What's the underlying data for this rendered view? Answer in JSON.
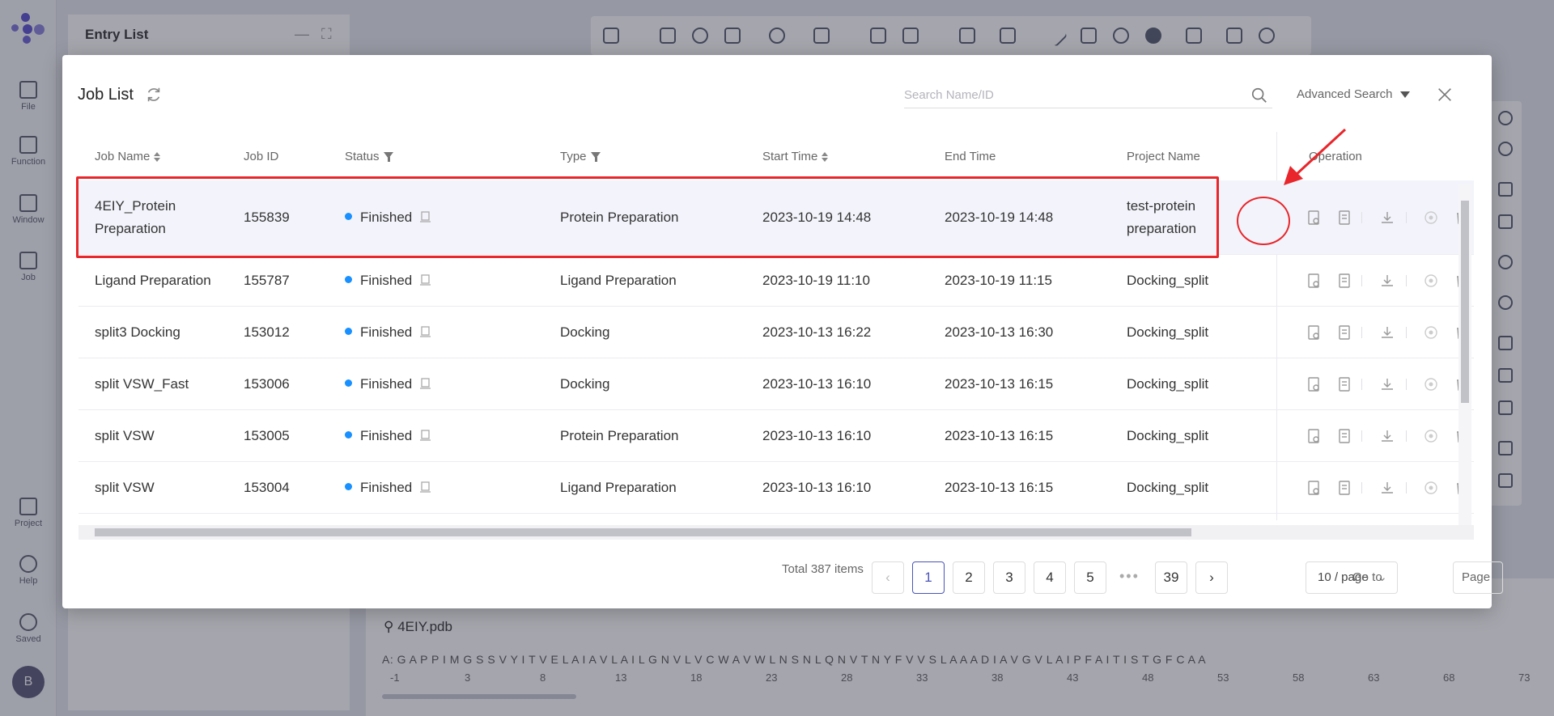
{
  "sidebar": {
    "items": [
      {
        "label": "File"
      },
      {
        "label": "Function"
      },
      {
        "label": "Window"
      },
      {
        "label": "Job"
      },
      {
        "label": "Project"
      },
      {
        "label": "Help"
      },
      {
        "label": "Saved"
      }
    ],
    "avatar": "B"
  },
  "entry_list": {
    "title": "Entry List"
  },
  "sequence": {
    "file": "4EIY.pdb",
    "chain": "A: G A P P I M G S S V Y I T V E L A I A V L A I L G N V L V C W A V W L N S N L Q N V T N Y F V V S L A A A D I A V G V L A I P F A I T I S T G F C A A",
    "numbers": [
      "-1",
      "3",
      "8",
      "13",
      "18",
      "23",
      "28",
      "33",
      "38",
      "43",
      "48",
      "53",
      "58",
      "63",
      "68",
      "73"
    ]
  },
  "dialog": {
    "title": "Job List",
    "search_placeholder": "Search Name/ID",
    "advanced_search": "Advanced Search",
    "columns": {
      "job_name": "Job Name",
      "job_id": "Job ID",
      "status": "Status",
      "type": "Type",
      "start_time": "Start Time",
      "end_time": "End Time",
      "project_name": "Project Name",
      "operation": "Operation"
    },
    "rows": [
      {
        "name": "4EIY_Protein Preparation",
        "id": "155839",
        "status": "Finished",
        "type": "Protein Preparation",
        "start": "2023-10-19 14:48",
        "end": "2023-10-19 14:48",
        "project": "test-protein preparation"
      },
      {
        "name": "Ligand Preparation",
        "id": "155787",
        "status": "Finished",
        "type": "Ligand Preparation",
        "start": "2023-10-19 11:10",
        "end": "2023-10-19 11:15",
        "project": "Docking_split"
      },
      {
        "name": "split3 Docking",
        "id": "153012",
        "status": "Finished",
        "type": "Docking",
        "start": "2023-10-13 16:22",
        "end": "2023-10-13 16:30",
        "project": "Docking_split"
      },
      {
        "name": "split VSW_Fast",
        "id": "153006",
        "status": "Finished",
        "type": "Docking",
        "start": "2023-10-13 16:10",
        "end": "2023-10-13 16:15",
        "project": "Docking_split"
      },
      {
        "name": "split VSW",
        "id": "153005",
        "status": "Finished",
        "type": "Protein Preparation",
        "start": "2023-10-13 16:10",
        "end": "2023-10-13 16:15",
        "project": "Docking_split"
      },
      {
        "name": "split VSW",
        "id": "153004",
        "status": "Finished",
        "type": "Ligand Preparation",
        "start": "2023-10-13 16:10",
        "end": "2023-10-13 16:15",
        "project": "Docking_split"
      }
    ],
    "status_color": "#1890ff",
    "pagination": {
      "total": "Total 387 items",
      "pages": [
        "1",
        "2",
        "3",
        "4",
        "5"
      ],
      "ellipsis": "•••",
      "last_page": "39",
      "page_size": "10 / page",
      "goto_label": "Go to",
      "page_label": "Page"
    }
  },
  "annotation_color": "#e8262b"
}
